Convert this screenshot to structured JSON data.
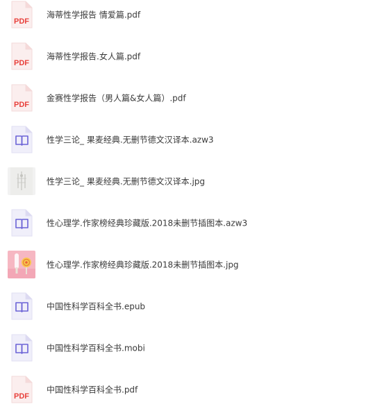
{
  "files": [
    {
      "name": "海蒂性学报告 情爱篇.pdf",
      "type": "pdf"
    },
    {
      "name": "海蒂性学报告.女人篇.pdf",
      "type": "pdf"
    },
    {
      "name": "金赛性学报告（男人篇&女人篇）.pdf",
      "type": "pdf"
    },
    {
      "name": "性学三论_ 果麦经典.无删节德文汉译本.azw3",
      "type": "ebook"
    },
    {
      "name": "性学三论_ 果麦经典.无删节德文汉译本.jpg",
      "type": "image"
    },
    {
      "name": "性心理学.作家榜经典珍藏版.2018未删节插图本.azw3",
      "type": "ebook"
    },
    {
      "name": "性心理学.作家榜经典珍藏版.2018未删节插图本.jpg",
      "type": "image"
    },
    {
      "name": "中国性科学百科全书.epub",
      "type": "ebook"
    },
    {
      "name": "中国性科学百科全书.mobi",
      "type": "ebook"
    },
    {
      "name": "中国性科学百科全书.pdf",
      "type": "pdf"
    }
  ],
  "icons": {
    "pdf_label": "PDF",
    "pdf_color": "#e8413c",
    "ebook_color": "#6b63d6"
  }
}
